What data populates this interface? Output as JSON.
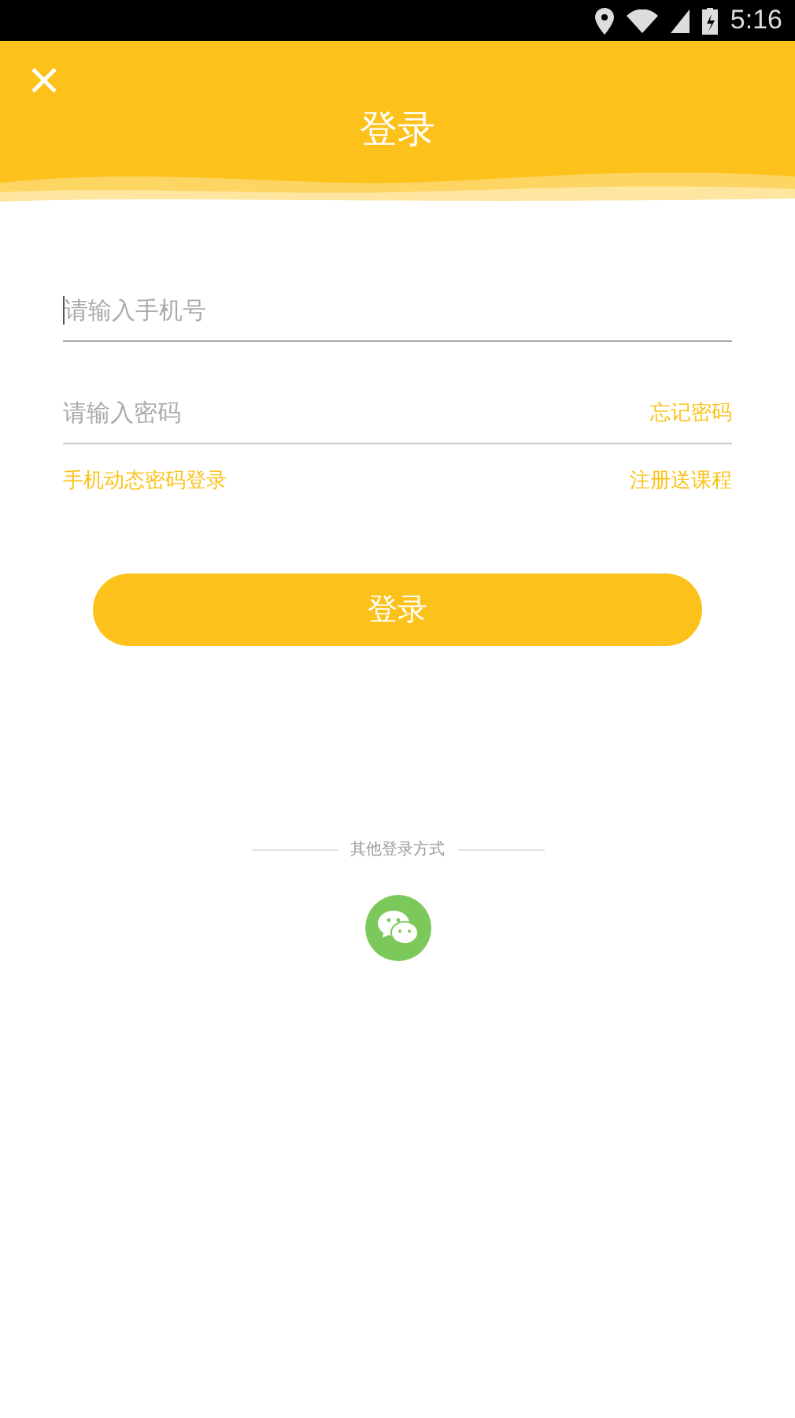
{
  "status_bar": {
    "time": "5:16"
  },
  "header": {
    "title": "登录"
  },
  "form": {
    "phone": {
      "placeholder": "请输入手机号",
      "focused": true
    },
    "password": {
      "placeholder": "请输入密码"
    },
    "forgot_link": "忘记密码",
    "sms_login_link": "手机动态密码登录",
    "register_link": "注册送课程",
    "submit_button": "登录"
  },
  "other_login": {
    "label": "其他登录方式"
  }
}
